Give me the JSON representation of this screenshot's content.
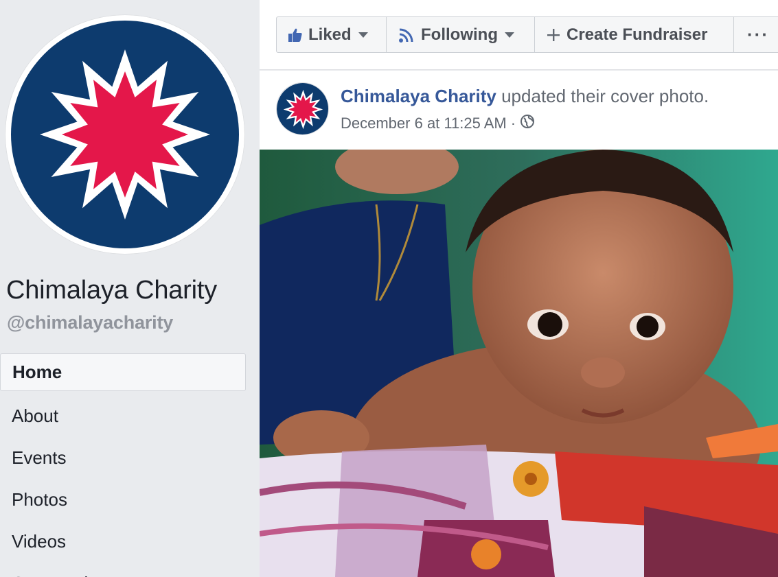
{
  "page": {
    "name": "Chimalaya Charity",
    "handle": "@chimalayacharity"
  },
  "nav": {
    "items": [
      {
        "label": "Home",
        "active": true
      },
      {
        "label": "About"
      },
      {
        "label": "Events"
      },
      {
        "label": "Photos"
      },
      {
        "label": "Videos"
      },
      {
        "label": "Community"
      }
    ]
  },
  "actions": {
    "liked": "Liked",
    "following": "Following",
    "fundraiser": "Create Fundraiser",
    "more": "···"
  },
  "post": {
    "author": "Chimalaya Charity",
    "action": " updated their cover photo.",
    "date": "December 6 at 11:25 AM",
    "separator": "·",
    "privacy_icon": "globe-icon"
  },
  "colors": {
    "logo_navy": "#0d3b6e",
    "logo_red": "#e4174a",
    "link_blue": "#365899",
    "fb_blue": "#4267b2"
  }
}
